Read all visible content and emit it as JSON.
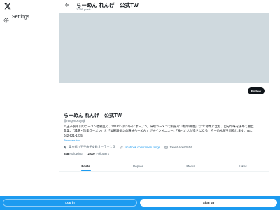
{
  "sidebar": {
    "logo_icon": "x-logo-icon",
    "settings_label": "Settings"
  },
  "header": {
    "title": "らーめん れんげ　公式TW",
    "post_count": "1,291 posts"
  },
  "profile": {
    "follow_label": "Follow",
    "name": "らーめん れんげ　公式TW",
    "handle": "@rengenocoyuji",
    "bio_lines": [
      "八王子駅南口のラーメン激戦区で、2018年4月24日にオープン。味噌ラーメンで有名な「麺や耕冶」で7年修業に立ち、自分の味を求めて独立",
      "開業。「濃厚・旨辛ラーメン」と「淡麗鶏ダシの醤油らーめん」がメインメニュー。「食べた人が幸せになる」らーめん屋を目指します。TEL",
      "042-621-1235"
    ],
    "translate_label": "Translate bio",
    "location": "東京都八王子市子安町３－７－１３",
    "website": "facebook.com/ramen.renge",
    "joined": "Joined April 2014",
    "following_count": "248",
    "following_label": "Following",
    "followers_count": "2,007",
    "followers_label": "Followers"
  },
  "tabs": [
    {
      "label": "Posts",
      "active": true
    },
    {
      "label": "Replies",
      "active": false
    },
    {
      "label": "Media",
      "active": false
    },
    {
      "label": "Likes",
      "active": false
    }
  ],
  "bottom_bar": {
    "login_label": "Log in",
    "signup_label": "Sign up"
  },
  "colors": {
    "accent": "#1d9bf0",
    "banner": "#cfd9de",
    "text_primary": "#0f1419",
    "text_secondary": "#536471"
  }
}
